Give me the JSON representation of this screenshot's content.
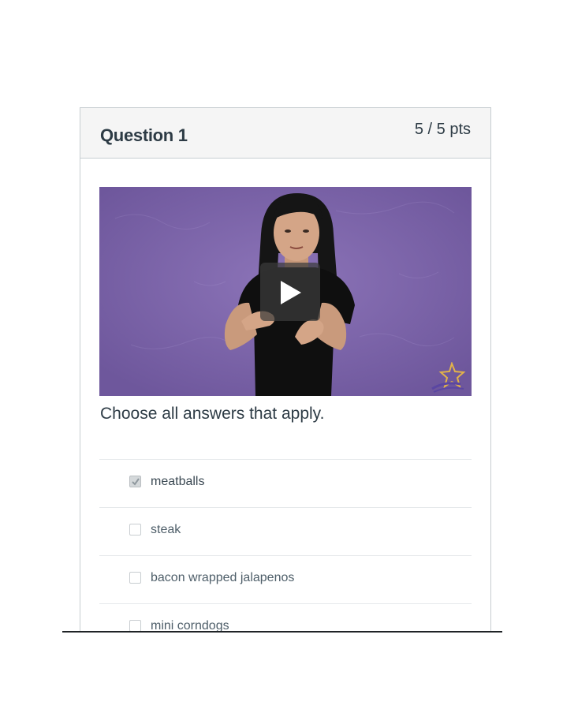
{
  "question": {
    "title": "Question 1",
    "points": "5 / 5 pts",
    "prompt": "Choose all answers that apply."
  },
  "video": {
    "background_color": "#7a62a6",
    "play_icon": "play-icon",
    "logo_icon": "star-logo-icon"
  },
  "answers": [
    {
      "label": "meatballs",
      "checked": true
    },
    {
      "label": "steak",
      "checked": false
    },
    {
      "label": "bacon wrapped jalapenos",
      "checked": false
    },
    {
      "label": "mini corndogs",
      "checked": false
    }
  ],
  "colors": {
    "header_bg": "#f5f5f5",
    "text": "#2d3b45",
    "border": "#c7cdd1"
  }
}
